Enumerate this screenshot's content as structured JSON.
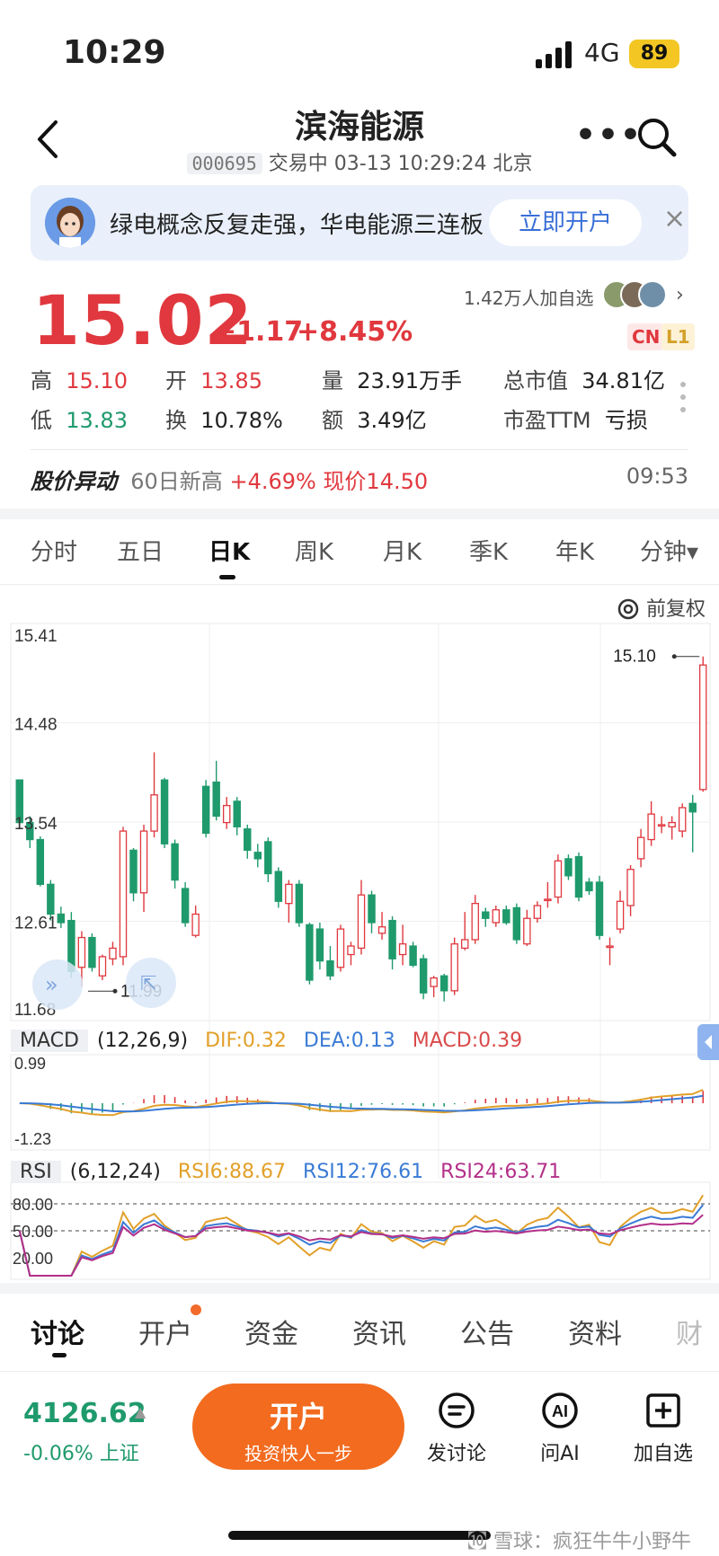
{
  "status_bar": {
    "time": "10:29",
    "network": "4G",
    "battery": "89"
  },
  "header": {
    "title": "滨海能源",
    "code": "000695",
    "status_line": "交易中 03-13 10:29:24 北京"
  },
  "banner": {
    "text": "绿电概念反复走强，华电能源三连板",
    "button": "立即开户",
    "close": "×"
  },
  "quote": {
    "price": "15.02",
    "change": "+1.17",
    "change_pct": "+8.45%",
    "watchers": "1.42万人加自选",
    "tags": [
      "CN",
      "L1"
    ],
    "stats": [
      {
        "label": "高",
        "value": "15.10",
        "color": "red"
      },
      {
        "label": "开",
        "value": "13.85",
        "color": "red"
      },
      {
        "label": "量",
        "value": "23.91万手",
        "color": "black"
      },
      {
        "label": "总市值",
        "value": "34.81亿",
        "color": "black"
      },
      {
        "label": "低",
        "value": "13.83",
        "color": "green"
      },
      {
        "label": "换",
        "value": "10.78%",
        "color": "black"
      },
      {
        "label": "额",
        "value": "3.49亿",
        "color": "black"
      },
      {
        "label": "市盈TTM",
        "value": "亏损",
        "color": "black"
      }
    ]
  },
  "alert": {
    "title": "股价异动",
    "text": "60日新高",
    "value": "+4.69% 现价14.50",
    "time": "09:53"
  },
  "period_tabs": [
    "分时",
    "五日",
    "日K",
    "周K",
    "月K",
    "季K",
    "年K",
    "分钟▾"
  ],
  "active_period": "日K",
  "adjust_label": "前复权",
  "chart_data": {
    "type": "candlestick",
    "y_labels": [
      "15.41",
      "14.48",
      "13.54",
      "12.61",
      "11.68"
    ],
    "ylim": [
      11.68,
      15.41
    ],
    "max_label": "15.10",
    "min_label": "11.99",
    "candles": [
      [
        13.94,
        13.54,
        13.92,
        13.49
      ],
      [
        13.54,
        13.38,
        13.6,
        13.3
      ],
      [
        13.38,
        12.96,
        13.41,
        12.94
      ],
      [
        12.96,
        12.68,
        13.0,
        12.62
      ],
      [
        12.68,
        12.6,
        12.75,
        12.55
      ],
      [
        12.62,
        12.14,
        12.7,
        12.08
      ],
      [
        12.18,
        12.46,
        12.52,
        12.0
      ],
      [
        12.46,
        12.18,
        12.5,
        12.14
      ],
      [
        12.1,
        12.28,
        12.3,
        12.06
      ],
      [
        12.26,
        12.36,
        12.42,
        12.2
      ],
      [
        12.28,
        13.46,
        13.5,
        12.2
      ],
      [
        13.28,
        12.88,
        13.3,
        12.8
      ],
      [
        12.88,
        13.46,
        13.52,
        12.7
      ],
      [
        13.46,
        13.8,
        14.2,
        13.4
      ],
      [
        13.94,
        13.34,
        13.96,
        13.3
      ],
      [
        13.34,
        13.0,
        13.38,
        12.92
      ],
      [
        12.92,
        12.6,
        12.98,
        12.56
      ],
      [
        12.48,
        12.68,
        12.76,
        12.46
      ],
      [
        13.88,
        13.44,
        13.94,
        13.4
      ],
      [
        13.92,
        13.6,
        14.12,
        13.56
      ],
      [
        13.54,
        13.7,
        13.78,
        13.48
      ],
      [
        13.74,
        13.5,
        13.78,
        13.42
      ],
      [
        13.48,
        13.28,
        13.52,
        13.2
      ],
      [
        13.26,
        13.2,
        13.34,
        13.12
      ],
      [
        13.36,
        13.06,
        13.4,
        12.98
      ],
      [
        13.08,
        12.8,
        13.12,
        12.74
      ],
      [
        12.78,
        12.96,
        13.0,
        12.6
      ],
      [
        12.96,
        12.6,
        13.0,
        12.56
      ],
      [
        12.58,
        12.06,
        12.6,
        12.02
      ],
      [
        12.54,
        12.24,
        12.6,
        12.16
      ],
      [
        12.24,
        12.1,
        12.38,
        12.06
      ],
      [
        12.18,
        12.54,
        12.58,
        12.14
      ],
      [
        12.3,
        12.38,
        12.42,
        12.2
      ],
      [
        12.36,
        12.86,
        13.0,
        12.3
      ],
      [
        12.86,
        12.6,
        12.9,
        12.5
      ],
      [
        12.5,
        12.56,
        12.7,
        12.44
      ],
      [
        12.62,
        12.26,
        12.66,
        12.16
      ],
      [
        12.3,
        12.4,
        12.58,
        12.2
      ],
      [
        12.38,
        12.2,
        12.42,
        12.18
      ],
      [
        12.26,
        11.94,
        12.3,
        11.88
      ],
      [
        12.0,
        12.08,
        12.1,
        11.9
      ],
      [
        12.1,
        11.96,
        12.12,
        11.86
      ],
      [
        11.96,
        12.4,
        12.46,
        11.92
      ],
      [
        12.36,
        12.44,
        12.7,
        12.34
      ],
      [
        12.44,
        12.78,
        12.86,
        12.4
      ],
      [
        12.7,
        12.64,
        12.74,
        12.56
      ],
      [
        12.6,
        12.72,
        12.76,
        12.56
      ],
      [
        12.72,
        12.6,
        12.76,
        12.58
      ],
      [
        12.74,
        12.44,
        12.78,
        12.4
      ],
      [
        12.4,
        12.64,
        12.72,
        12.38
      ],
      [
        12.64,
        12.76,
        12.8,
        12.6
      ],
      [
        12.82,
        12.82,
        12.98,
        12.74
      ],
      [
        12.84,
        13.18,
        13.24,
        12.78
      ],
      [
        13.2,
        13.04,
        13.24,
        13.0
      ],
      [
        13.22,
        12.84,
        13.26,
        12.8
      ],
      [
        12.98,
        12.9,
        13.02,
        12.86
      ],
      [
        12.98,
        12.48,
        13.04,
        12.44
      ],
      [
        12.38,
        12.38,
        12.46,
        12.2
      ],
      [
        12.54,
        12.8,
        12.9,
        12.5
      ],
      [
        12.76,
        13.1,
        13.14,
        12.66
      ],
      [
        13.2,
        13.4,
        13.48,
        13.12
      ],
      [
        13.38,
        13.62,
        13.74,
        13.32
      ],
      [
        13.52,
        13.52,
        13.6,
        13.44
      ],
      [
        13.5,
        13.54,
        13.6,
        13.38
      ],
      [
        13.46,
        13.68,
        13.72,
        13.4
      ],
      [
        13.72,
        13.64,
        13.8,
        13.26
      ],
      [
        13.85,
        15.02,
        15.1,
        13.83
      ]
    ]
  },
  "macd": {
    "label": "MACD",
    "params": "(12,26,9)",
    "dif": "DIF:0.32",
    "dea": "DEA:0.13",
    "macd": "MACD:0.39",
    "top_label": "0.99",
    "bottom_label": "-1.23",
    "colors": {
      "dif": "#e2a02a",
      "dea": "#3a7bd5",
      "macd": "#d94a4a"
    }
  },
  "rsi": {
    "label": "RSI",
    "params": "(6,12,24)",
    "rsi6": "RSI6:88.67",
    "rsi12": "RSI12:76.61",
    "rsi24": "RSI24:63.71",
    "levels": [
      "80.00",
      "50.00",
      "20.00"
    ],
    "colors": {
      "rsi6": "#e2a02a",
      "rsi12": "#3a7bd5",
      "rsi24": "#b3308a"
    }
  },
  "bottom_tabs": [
    "讨论",
    "开户",
    "资金",
    "资讯",
    "公告",
    "资料",
    "财"
  ],
  "active_bottom_tab": "讨论",
  "index": {
    "value": "4126.62",
    "change": "-0.06%",
    "name": "上证"
  },
  "open_account": {
    "title": "开户",
    "subtitle": "投资快人一步"
  },
  "tools": [
    {
      "label": "发讨论",
      "icon": "discuss-icon"
    },
    {
      "label": "问AI",
      "icon": "ai-icon"
    },
    {
      "label": "加自选",
      "icon": "add-watch-icon"
    }
  ],
  "watermark": "㉈ 雪球：疯狂牛牛小野牛"
}
